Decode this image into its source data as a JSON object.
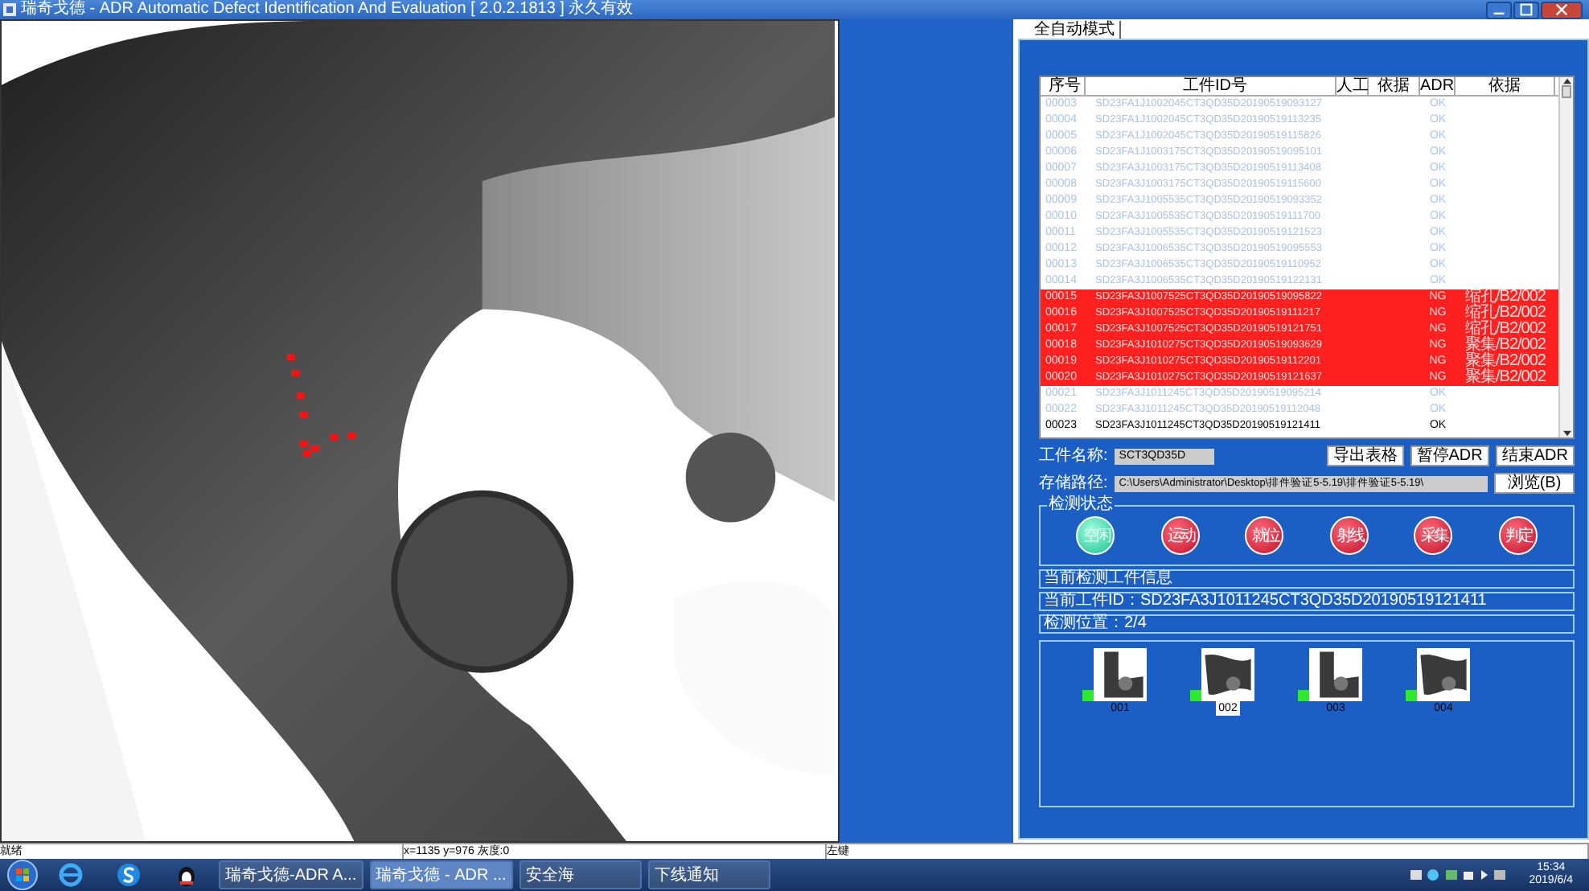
{
  "window": {
    "title": "瑞奇戈德 - ADR Automatic Defect Identification And Evaluation [ 2.0.2.1813 ] 永久有效"
  },
  "tabs": [
    {
      "label": "全自动模式",
      "selected": true
    }
  ],
  "table": {
    "columns": [
      "序号",
      "工件ID号",
      "人工",
      "依据",
      "ADR",
      "依据"
    ],
    "rows": [
      {
        "cells": [
          "00003",
          "SD23FA1J1002045CT3QD35D20190519093127",
          "",
          "",
          "OK",
          ""
        ],
        "flagged": false,
        "current": false
      },
      {
        "cells": [
          "00004",
          "SD23FA1J1002045CT3QD35D20190519113235",
          "",
          "",
          "OK",
          ""
        ],
        "flagged": false,
        "current": false
      },
      {
        "cells": [
          "00005",
          "SD23FA1J1002045CT3QD35D20190519115826",
          "",
          "",
          "OK",
          ""
        ],
        "flagged": false,
        "current": false
      },
      {
        "cells": [
          "00006",
          "SD23FA1J1003175CT3QD35D20190519095101",
          "",
          "",
          "OK",
          ""
        ],
        "flagged": false,
        "current": false
      },
      {
        "cells": [
          "00007",
          "SD23FA3J1003175CT3QD35D20190519113408",
          "",
          "",
          "OK",
          ""
        ],
        "flagged": false,
        "current": false
      },
      {
        "cells": [
          "00008",
          "SD23FA3J1003175CT3QD35D20190519115600",
          "",
          "",
          "OK",
          ""
        ],
        "flagged": false,
        "current": false
      },
      {
        "cells": [
          "00009",
          "SD23FA3J1005535CT3QD35D20190519093352",
          "",
          "",
          "OK",
          ""
        ],
        "flagged": false,
        "current": false
      },
      {
        "cells": [
          "00010",
          "SD23FA3J1005535CT3QD35D20190519111700",
          "",
          "",
          "OK",
          ""
        ],
        "flagged": false,
        "current": false
      },
      {
        "cells": [
          "00011",
          "SD23FA3J1005535CT3QD35D20190519121523",
          "",
          "",
          "OK",
          ""
        ],
        "flagged": false,
        "current": false
      },
      {
        "cells": [
          "00012",
          "SD23FA3J1006535CT3QD35D20190519095553",
          "",
          "",
          "OK",
          ""
        ],
        "flagged": false,
        "current": false
      },
      {
        "cells": [
          "00013",
          "SD23FA3J1006535CT3QD35D20190519110952",
          "",
          "",
          "OK",
          ""
        ],
        "flagged": false,
        "current": false
      },
      {
        "cells": [
          "00014",
          "SD23FA3J1006535CT3QD35D20190519122131",
          "",
          "",
          "OK",
          ""
        ],
        "flagged": false,
        "current": false
      },
      {
        "cells": [
          "00015",
          "SD23FA3J1007525CT3QD35D20190519095822",
          "",
          "",
          "NG",
          "缩孔/B2/002"
        ],
        "flagged": true,
        "current": false
      },
      {
        "cells": [
          "00016",
          "SD23FA3J1007525CT3QD35D20190519111217",
          "",
          "",
          "NG",
          "缩孔/B2/002"
        ],
        "flagged": true,
        "current": false
      },
      {
        "cells": [
          "00017",
          "SD23FA3J1007525CT3QD35D20190519121751",
          "",
          "",
          "NG",
          "缩孔/B2/002"
        ],
        "flagged": true,
        "current": false
      },
      {
        "cells": [
          "00018",
          "SD23FA3J1010275CT3QD35D20190519093629",
          "",
          "",
          "NG",
          "聚集/B2/002"
        ],
        "flagged": true,
        "current": false
      },
      {
        "cells": [
          "00019",
          "SD23FA3J1010275CT3QD35D20190519112201",
          "",
          "",
          "NG",
          "聚集/B2/002"
        ],
        "flagged": true,
        "current": false
      },
      {
        "cells": [
          "00020",
          "SD23FA3J1010275CT3QD35D20190519121637",
          "",
          "",
          "NG",
          "聚集/B2/002"
        ],
        "flagged": true,
        "current": false
      },
      {
        "cells": [
          "00021",
          "SD23FA3J1011245CT3QD35D20190519095214",
          "",
          "",
          "OK",
          ""
        ],
        "flagged": false,
        "current": false
      },
      {
        "cells": [
          "00022",
          "SD23FA3J1011245CT3QD35D20190519112048",
          "",
          "",
          "OK",
          ""
        ],
        "flagged": false,
        "current": false
      },
      {
        "cells": [
          "00023",
          "SD23FA3J1011245CT3QD35D20190519121411",
          "",
          "",
          "OK",
          ""
        ],
        "flagged": false,
        "current": true
      }
    ]
  },
  "form": {
    "name_label": "工件名称:",
    "name_value": "SCT3QD35D",
    "path_label": "存储路径:",
    "path_value": "C:\\Users\\Administrator\\Desktop\\排件验证5-5.19\\排件验证5-5.19\\",
    "browse_button": "浏览(B)",
    "buttons": [
      "导出表格",
      "暂停ADR",
      "结束ADR"
    ]
  },
  "status_group": {
    "title": "检测状态",
    "lights": [
      {
        "label": "空闲",
        "on": true
      },
      {
        "label": "运动",
        "on": false
      },
      {
        "label": "就位",
        "on": false
      },
      {
        "label": "射线",
        "on": false
      },
      {
        "label": "采集",
        "on": false
      },
      {
        "label": "判定",
        "on": false
      }
    ]
  },
  "info": [
    "当前检测工件信息",
    "当前工件ID：SD23FA3J1011245CT3QD35D20190519121411",
    "检测位置：2/4"
  ],
  "thumbnails": [
    {
      "label": "001",
      "selected": false
    },
    {
      "label": "002",
      "selected": true
    },
    {
      "label": "003",
      "selected": false
    },
    {
      "label": "004",
      "selected": false
    }
  ],
  "status_bar": [
    "就绪",
    "x=1135 y=976 灰度:0",
    "左键"
  ],
  "taskbar": {
    "tasks": [
      {
        "label": "瑞奇戈德-ADR A...",
        "selected": false
      },
      {
        "label": "瑞奇戈德 - ADR ...",
        "selected": true
      },
      {
        "label": "安全海",
        "selected": false
      },
      {
        "label": "下线通知",
        "selected": false
      }
    ],
    "time": "15:34",
    "date": "2019/6/4"
  }
}
